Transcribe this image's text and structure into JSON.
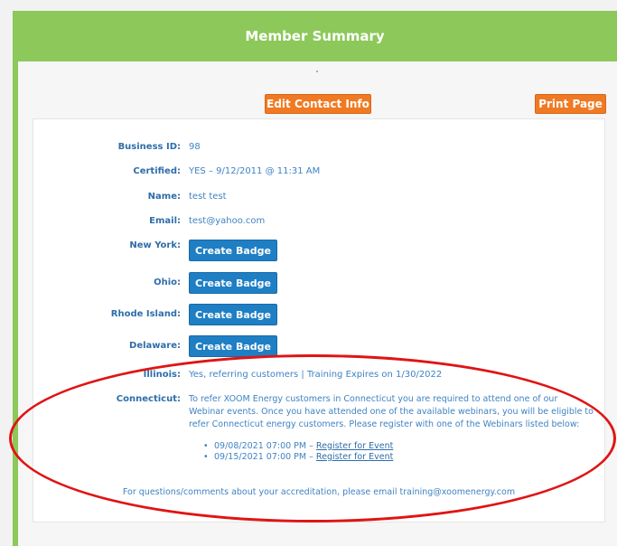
{
  "header": {
    "title": "Member Summary"
  },
  "actions": {
    "edit_label": "Edit Contact Info",
    "print_label": "Print Page"
  },
  "member": {
    "business_id_label": "Business ID:",
    "business_id": "98",
    "certified_label": "Certified:",
    "certified": "YES  –  9/12/2011 @ 11:31 AM",
    "name_label": "Name:",
    "name": "test test",
    "email_label": "Email:",
    "email": "test@yahoo.com"
  },
  "states": {
    "new_york_label": "New York:",
    "ohio_label": "Ohio:",
    "rhode_island_label": "Rhode Island:",
    "delaware_label": "Delaware:",
    "badge_label": "Create Badge",
    "illinois_label": "Illinois:",
    "illinois_status": "Yes, referring customers | Training Expires on 1/30/2022",
    "connecticut_label": "Connecticut:",
    "connecticut_text": "To refer XOOM Energy customers in Connecticut you are required to attend one of our Webinar events. Once you have attended one of the available webinars, you will be eligible to refer Connecticut energy customers. Please register with one of the Webinars listed below:"
  },
  "webinars": [
    {
      "datetime": "09/08/2021 07:00 PM",
      "link": "Register for Event"
    },
    {
      "datetime": "09/15/2021 07:00 PM",
      "link": "Register for Event"
    }
  ],
  "footer": {
    "note": "For questions/comments about your accreditation, please email training@xoomenergy.com"
  },
  "colors": {
    "header_green": "#8cc85a",
    "button_orange": "#f07a23",
    "badge_blue": "#1f7fc4",
    "text_blue": "#3f83c4",
    "annotation_red": "#e01414"
  }
}
